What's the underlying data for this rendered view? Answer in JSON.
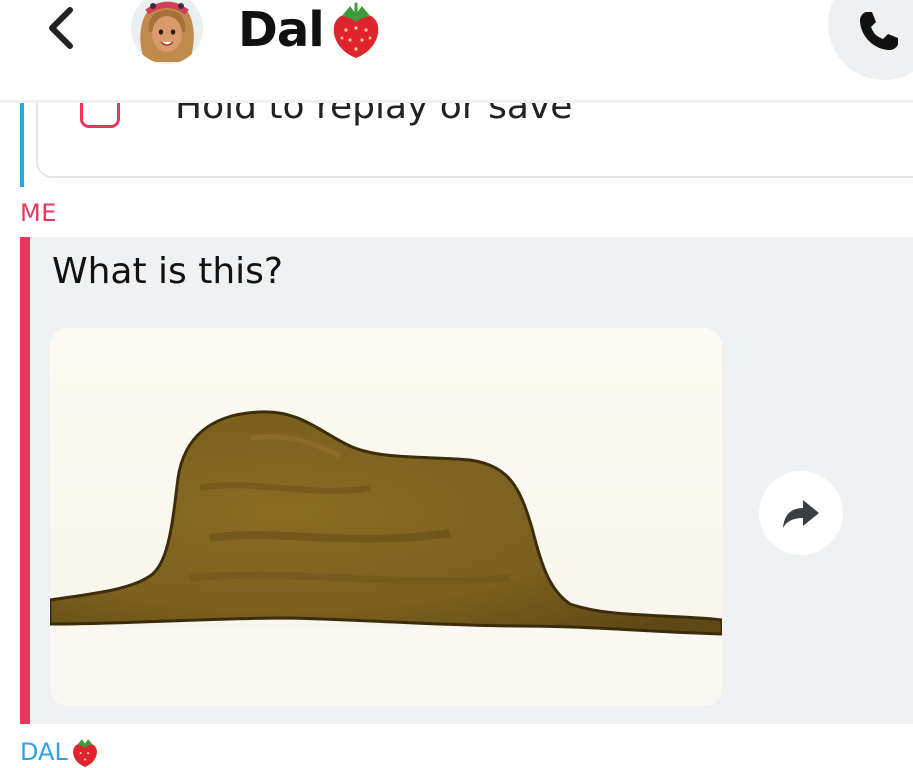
{
  "header": {
    "contact_name": "Dal",
    "icons": {
      "back": "chevron-left-icon",
      "avatar": "bitmoji-avatar",
      "call": "phone-icon",
      "emoji": "strawberry-emoji"
    }
  },
  "previous_message": {
    "text": "Hold to replay or save",
    "icon": "snap-square-icon"
  },
  "conversation": {
    "sender_me": "ME",
    "sender_other": "DAL",
    "message_text": "What is this?",
    "image": {
      "content": "drawing-brown-hat-shape",
      "forward_icon": "share-arrow-icon"
    }
  },
  "colors": {
    "me_accent": "#e8375a",
    "friend_accent": "#2fa3e6",
    "message_background": "#f0f1f3",
    "header_background": "#ffffff"
  }
}
